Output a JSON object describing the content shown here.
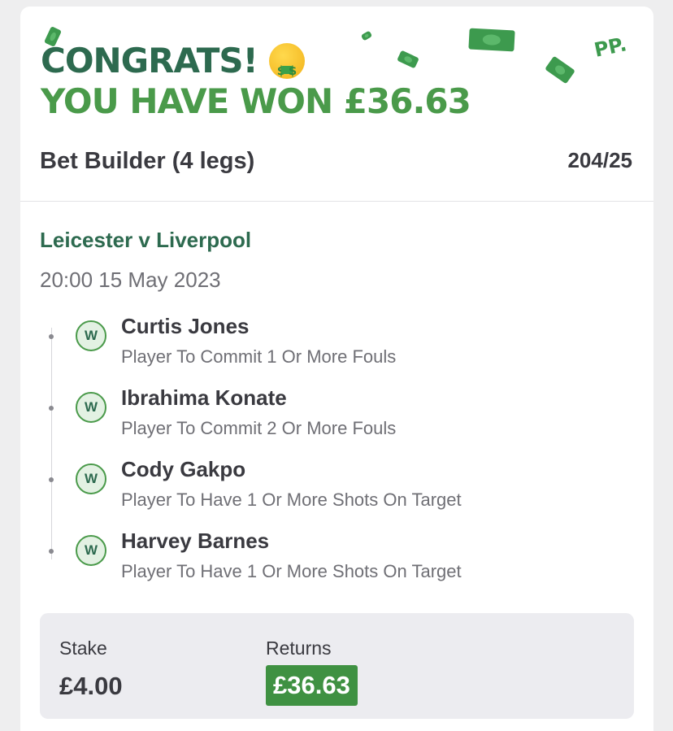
{
  "banner": {
    "congrats": "CONGRATS!",
    "won_text": "YOU HAVE WON £36.63",
    "emoji_icon": "money-mouth-face-icon",
    "brand_mark": "PP."
  },
  "bet": {
    "type": "Bet Builder (4 legs)",
    "odds": "204/25"
  },
  "match": {
    "title": "Leicester v Liverpool",
    "datetime": "20:00 15 May 2023"
  },
  "legs": [
    {
      "badge": "W",
      "player": "Curtis Jones",
      "market": "Player To Commit 1 Or More Fouls"
    },
    {
      "badge": "W",
      "player": "Ibrahima Konate",
      "market": "Player To Commit 2 Or More Fouls"
    },
    {
      "badge": "W",
      "player": "Cody Gakpo",
      "market": "Player To Have 1 Or More Shots On Target"
    },
    {
      "badge": "W",
      "player": "Harvey Barnes",
      "market": "Player To Have 1 Or More Shots On Target"
    }
  ],
  "summary": {
    "stake_label": "Stake",
    "stake_value": "£4.00",
    "returns_label": "Returns",
    "returns_value": "£36.63"
  },
  "colors": {
    "dark_green": "#2d6a4f",
    "green": "#4a9a4a",
    "returns_bg": "#3f9142"
  }
}
